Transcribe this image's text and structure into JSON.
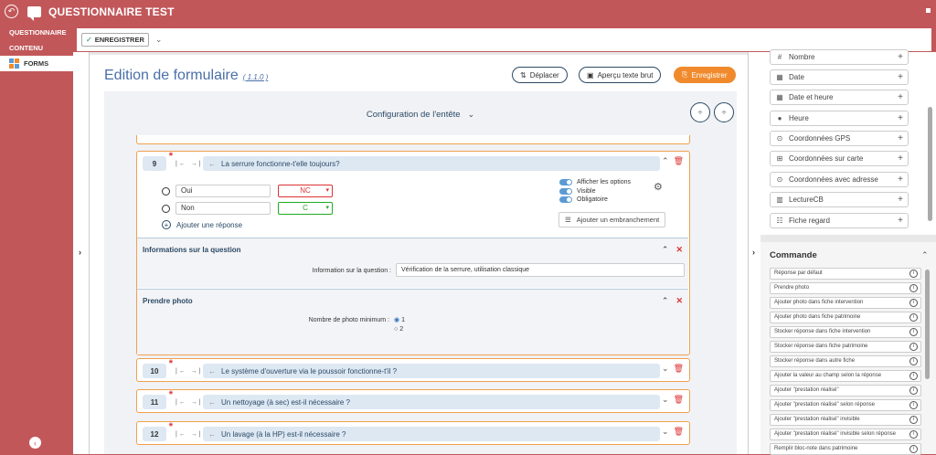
{
  "app": {
    "title": "QUESTIONNAIRE TEST"
  },
  "sidebar": {
    "items": [
      {
        "label": "QUESTIONNAIRE"
      },
      {
        "label": "CONTENU"
      },
      {
        "label": "FORMS"
      }
    ]
  },
  "toolbar": {
    "save_label": "ENREGISTRER"
  },
  "header": {
    "title": "Edition de formulaire",
    "version": "( 1.1.0 )",
    "move_label": "Déplacer",
    "preview_label": "Aperçu texte brut",
    "save_label": "Enregistrer"
  },
  "config": {
    "label": "Configuration de l'entête"
  },
  "q9": {
    "number": "9",
    "title": "La serrure fonctionne-t'elle toujours?",
    "answers": [
      {
        "text": "Oui",
        "value": "NC",
        "color": "#d33"
      },
      {
        "text": "Non",
        "value": "C",
        "color": "#2a2"
      }
    ],
    "add_answer": "Ajouter une réponse",
    "options": [
      "Afficher les options",
      "Visible",
      "Obligatoire"
    ],
    "branch": "Ajouter un embranchement"
  },
  "info_section": {
    "title": "Informations sur la question",
    "label": "Information sur la question :",
    "value": "Vérification de la serrure, utilisation classique"
  },
  "photo_section": {
    "title": "Prendre photo",
    "label": "Nombre de photo minimum :",
    "options": [
      "1",
      "2"
    ],
    "selected": "1"
  },
  "questions": [
    {
      "number": "10",
      "title": "Le système d'ouverture via le poussoir fonctionne-t'il ?"
    },
    {
      "number": "11",
      "title": "Un nettoyage (à sec) est-il nécessaire ?"
    },
    {
      "number": "12",
      "title": "Un lavage (à la HP) est-il nécessaire ?"
    }
  ],
  "fields": [
    {
      "label": "Nombre",
      "icon": "number-icon"
    },
    {
      "label": "Date",
      "icon": "calendar-icon"
    },
    {
      "label": "Date et heure",
      "icon": "calendar-clock-icon"
    },
    {
      "label": "Heure",
      "icon": "clock-icon"
    },
    {
      "label": "Coordonnées GPS",
      "icon": "map-pin-icon"
    },
    {
      "label": "Coordonnées sur carte",
      "icon": "map-icon"
    },
    {
      "label": "Coordonnées avec adresse",
      "icon": "map-pin-icon"
    },
    {
      "label": "LectureCB",
      "icon": "barcode-icon"
    },
    {
      "label": "Fiche regard",
      "icon": "checklist-icon"
    }
  ],
  "commands": {
    "title": "Commande",
    "items": [
      "Réponse par défaut",
      "Prendre photo",
      "Ajouter photo dans fiche intervention",
      "Ajouter photo dans fiche patrimoine",
      "Stocker réponse dans fiche intervention",
      "Stocker réponse dans fiche patrimoine",
      "Stocker réponse dans autre fiche",
      "Ajouter la valeur au champ selon la réponse",
      "Ajouter \"prestation réalisé\"",
      "Ajouter \"prestation réalisé\" selon réponse",
      "Ajouter \"prestation réalisé\" invisible",
      "Ajouter \"prestation réalisé\" invisible selon réponse",
      "Remplir bloc-note dans patrimoine"
    ]
  }
}
